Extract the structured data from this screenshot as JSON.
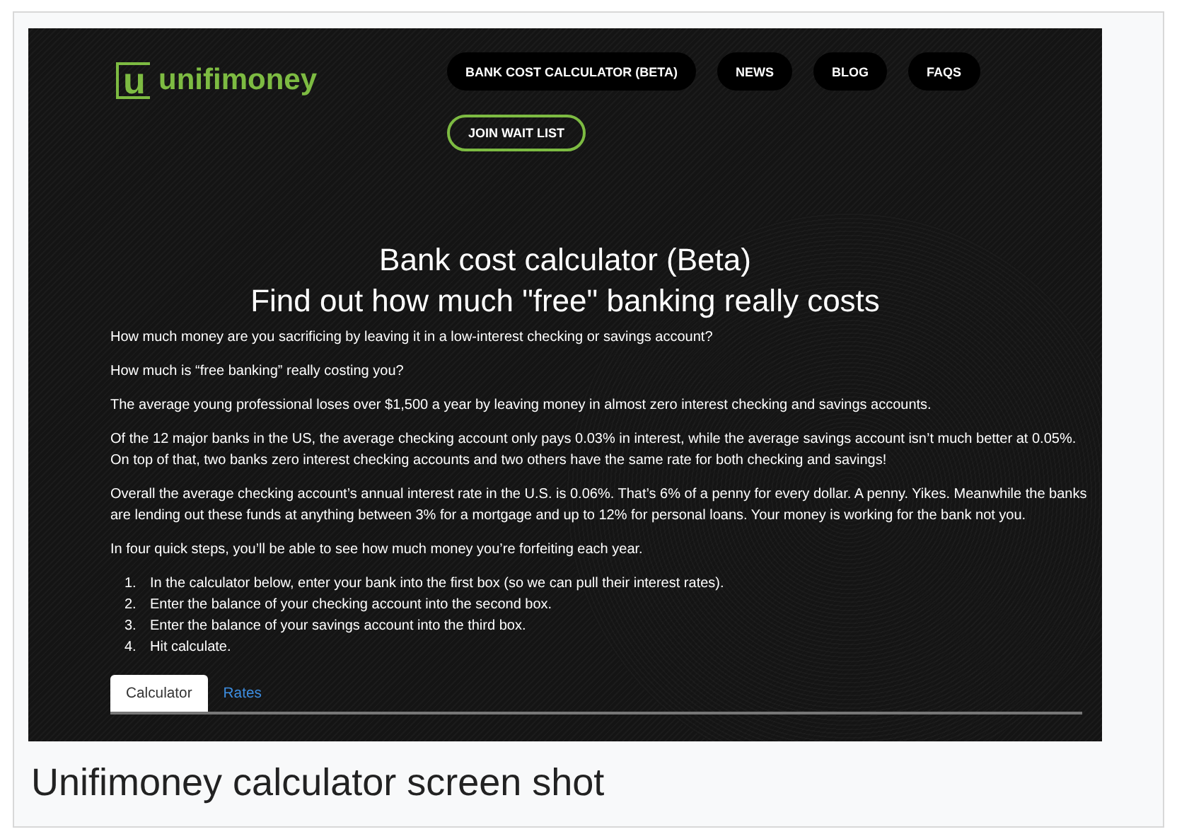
{
  "logo": {
    "mark": "u",
    "text": "unifimoney"
  },
  "nav": [
    {
      "label": "BANK COST CALCULATOR (BETA)",
      "kind": "pill"
    },
    {
      "label": "NEWS",
      "kind": "pill"
    },
    {
      "label": "BLOG",
      "kind": "pill"
    },
    {
      "label": "FAQS",
      "kind": "pill"
    },
    {
      "label": "JOIN WAIT LIST",
      "kind": "outline"
    }
  ],
  "heading": [
    "Bank cost calculator (Beta)",
    "Find out how much \"free\" banking really costs"
  ],
  "paragraphs": [
    "How much money are you sacrificing by leaving it in a low-interest checking or savings account?",
    "How much is “free banking” really costing you?",
    "The average young professional loses over $1,500 a year by leaving money in almost zero interest checking and savings accounts.",
    "Of the 12 major banks in the US, the average checking account only pays 0.03% in interest, while the average savings account isn’t much better at 0.05%. On top of that, two banks zero interest checking accounts and two others have the same rate for both checking and savings!",
    "Overall the average checking account’s annual interest rate in the U.S. is 0.06%. That’s 6% of a penny for every dollar. A penny. Yikes. Meanwhile the banks are lending out these funds at anything between 3% for a mortgage and up to 12% for personal loans. Your money is working for the bank not you.",
    "In four quick steps, you’ll be able to see how much money you’re forfeiting each year."
  ],
  "steps": [
    {
      "number": "1.",
      "text": "In the calculator below, enter your bank into the first box (so we can pull their interest rates)."
    },
    {
      "number": "2.",
      "text": "Enter the balance of your checking account into the second box."
    },
    {
      "number": "3.",
      "text": "Enter the balance of your savings account into the third box."
    },
    {
      "number": "4.",
      "text": "Hit calculate."
    }
  ],
  "tabs": [
    {
      "label": "Calculator",
      "selected": true
    },
    {
      "label": "Rates",
      "selected": false
    }
  ],
  "caption": "Unifimoney calculator screen shot"
}
